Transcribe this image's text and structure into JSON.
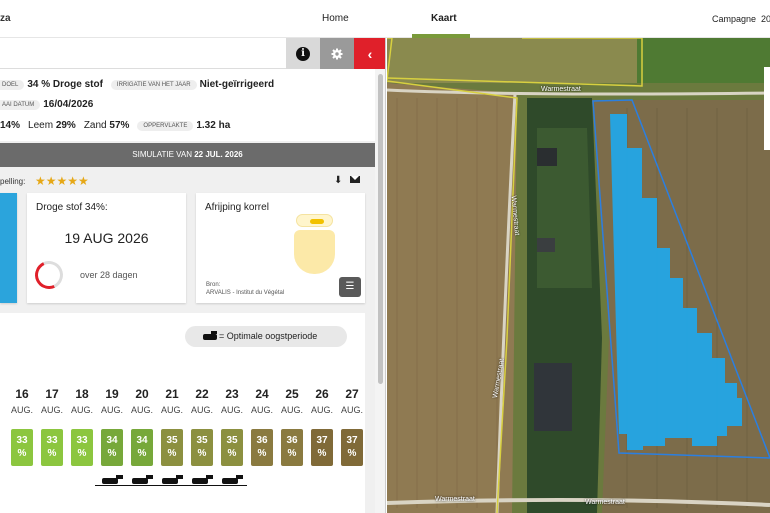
{
  "nav": {
    "brand": "za",
    "home": "Home",
    "kaart": "Kaart",
    "campagne_label": "Campagne",
    "campagne_year": "20"
  },
  "field": {
    "doel_label": "DOEL",
    "doel_value": "34 % Droge stof",
    "irrigatie_label": "IRRIGATIE VAN HET JAAR",
    "irrigatie_value": "Niet-geïrrigeerd",
    "zaai_label": "AAI DATUM",
    "zaai_value": "16/04/2026",
    "soil_prefix": "14%",
    "leem_label": "Leem",
    "leem_value": "29%",
    "zand_label": "Zand",
    "zand_value": "57%",
    "oppervlakte_label": "OPPERVLAKTE",
    "oppervlakte_value": "1.32 ha"
  },
  "simulation": {
    "prefix": "SIMULATIE VAN",
    "date": "22 JUL. 2026"
  },
  "rating": {
    "label": "pelling:",
    "stars": "★★★★★"
  },
  "droge_card": {
    "title": "Droge stof 34%:",
    "date": "19 AUG 2026",
    "days": "over 28 dagen"
  },
  "afrijping_card": {
    "title": "Afrijping korrel",
    "source_label": "Bron:",
    "source_value": "ARVALIS - Institut du Végétal"
  },
  "legend": {
    "text": "= Optimale oogstperiode"
  },
  "days": [
    {
      "num": "16",
      "mon": "AUG.",
      "pct": "33",
      "color": "#8cc63f"
    },
    {
      "num": "17",
      "mon": "AUG.",
      "pct": "33",
      "color": "#8cc63f"
    },
    {
      "num": "18",
      "mon": "AUG.",
      "pct": "33",
      "color": "#8cc63f"
    },
    {
      "num": "19",
      "mon": "AUG.",
      "pct": "34",
      "color": "#77a83a"
    },
    {
      "num": "20",
      "mon": "AUG.",
      "pct": "34",
      "color": "#77a83a"
    },
    {
      "num": "21",
      "mon": "AUG.",
      "pct": "35",
      "color": "#8c9040"
    },
    {
      "num": "22",
      "mon": "AUG.",
      "pct": "35",
      "color": "#8c9040"
    },
    {
      "num": "23",
      "mon": "AUG.",
      "pct": "35",
      "color": "#8c9040"
    },
    {
      "num": "24",
      "mon": "AUG.",
      "pct": "36",
      "color": "#8a7a40"
    },
    {
      "num": "25",
      "mon": "AUG.",
      "pct": "36",
      "color": "#8a7a40"
    },
    {
      "num": "26",
      "mon": "AUG.",
      "pct": "37",
      "color": "#806a38"
    },
    {
      "num": "27",
      "mon": "AUG.",
      "pct": "37",
      "color": "#806a38"
    }
  ],
  "pct_suffix": "%",
  "map": {
    "road_labels": [
      "Warmestraat",
      "Warmestraat",
      "Warmestraat",
      "Warmestraat",
      "Warmestraat"
    ]
  },
  "colors": {
    "accent_red": "#e0202a",
    "nav_underline": "#7a9a3a",
    "star": "#e6a817",
    "field_blue": "#2ba4dc"
  }
}
